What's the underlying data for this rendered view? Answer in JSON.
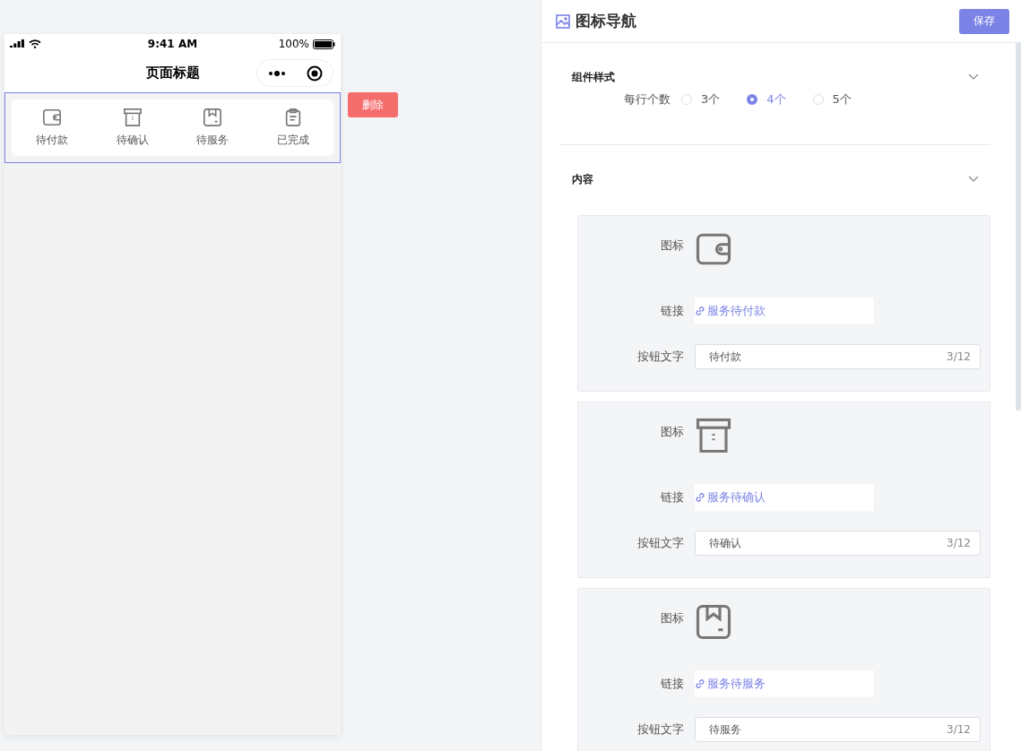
{
  "phone": {
    "time": "9:41 AM",
    "battery": "100%",
    "title": "页面标题"
  },
  "preview": {
    "selected": true,
    "items": [
      {
        "kind": "wallet",
        "label": "待付款"
      },
      {
        "kind": "box",
        "label": "待确认"
      },
      {
        "kind": "package",
        "label": "待服务"
      },
      {
        "kind": "clipboard",
        "label": "已完成"
      }
    ]
  },
  "delete_button": "删除",
  "panel": {
    "title": "图标导航",
    "save_button": "保存",
    "style_section": {
      "title": "组件样式",
      "expanded": true,
      "field_label": "每行个数",
      "options": [
        {
          "label": "3个",
          "selected": false
        },
        {
          "label": "4个",
          "selected": true
        },
        {
          "label": "5个",
          "selected": false
        }
      ]
    },
    "content_section": {
      "title": "内容",
      "expanded": true,
      "items": [
        {
          "kind": "wallet",
          "icon_label": "图标",
          "link_label": "链接",
          "link": "服务待付款",
          "text_label": "按钮文字",
          "text": "待付款",
          "count": "3/12"
        },
        {
          "kind": "box",
          "icon_label": "图标",
          "link_label": "链接",
          "link": "服务待确认",
          "text_label": "按钮文字",
          "text": "待确认",
          "count": "3/12"
        },
        {
          "kind": "package",
          "icon_label": "图标",
          "link_label": "链接",
          "link": "服务待服务",
          "text_label": "按钮文字",
          "text": "待服务",
          "count": "3/12"
        }
      ]
    }
  }
}
